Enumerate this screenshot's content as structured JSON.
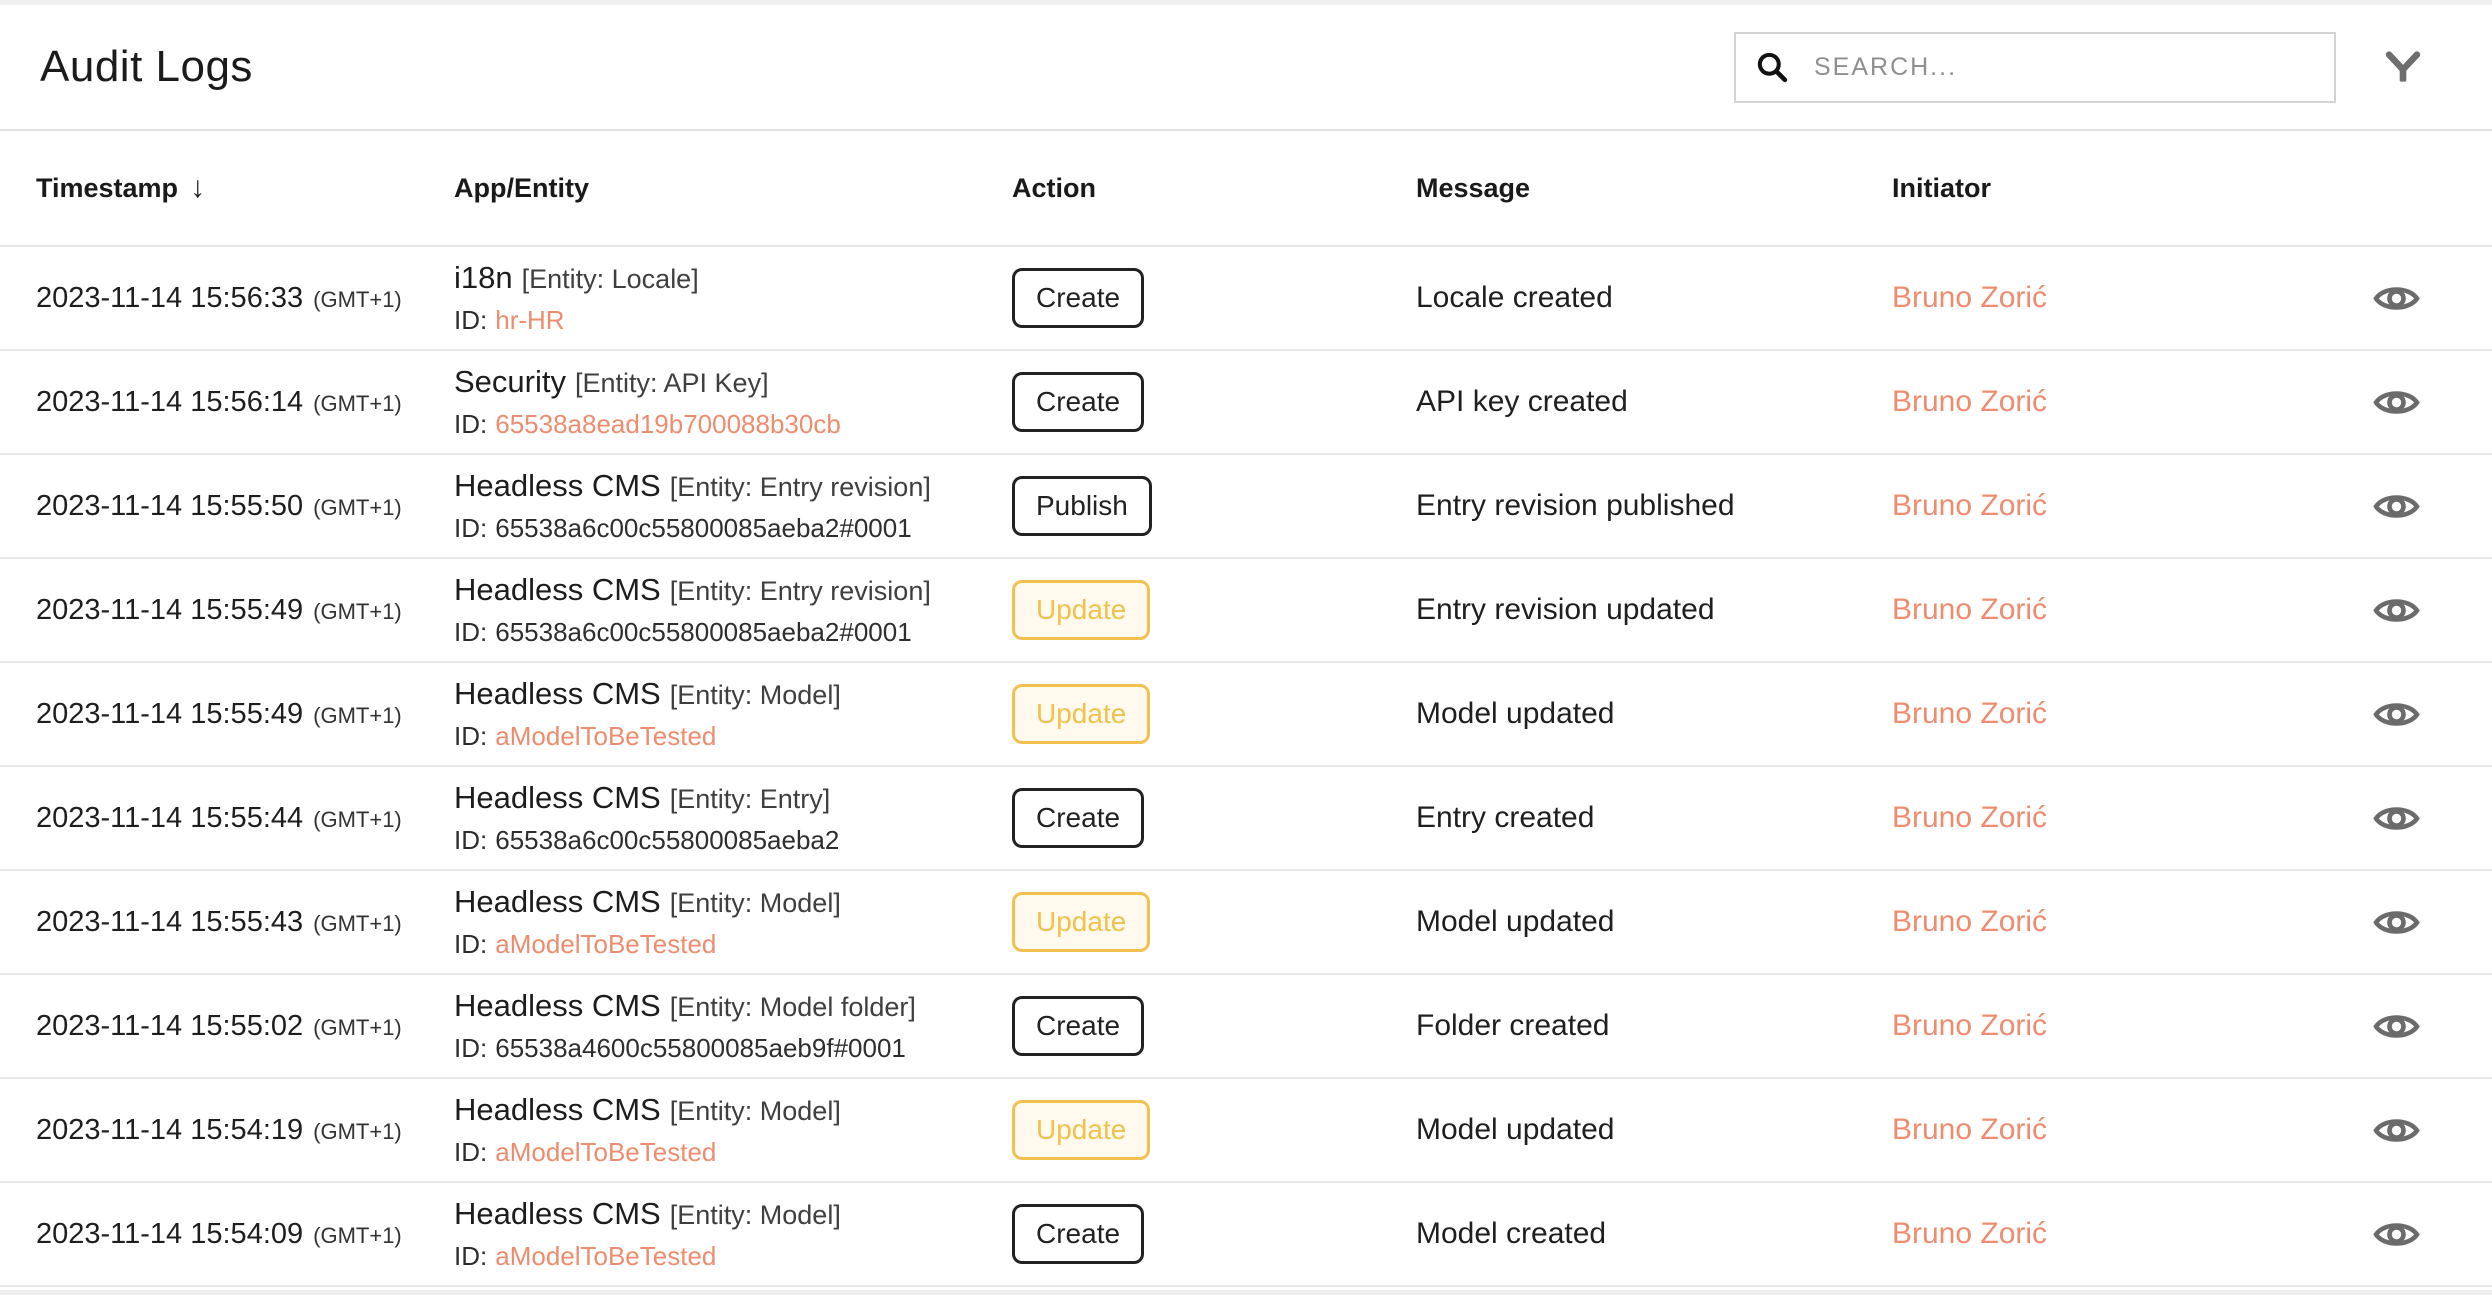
{
  "header": {
    "title": "Audit Logs",
    "search_placeholder": "SEARCH...",
    "icons": {
      "search": "magnifier-icon",
      "filter": "funnel-filter-icon"
    }
  },
  "table": {
    "columns": [
      {
        "label": "Timestamp",
        "sorted": "desc"
      },
      {
        "label": "App/Entity"
      },
      {
        "label": "Action"
      },
      {
        "label": "Message"
      },
      {
        "label": "Initiator"
      }
    ],
    "sort_arrow": "↓",
    "row_action_icon": "eye-icon",
    "rows": [
      {
        "timestamp": "2023-11-14 15:56:33",
        "timezone": "(GMT+1)",
        "app": "i18n",
        "entity": "[Entity: Locale]",
        "id_label": "ID:",
        "id": "hr-HR",
        "id_is_link": true,
        "action": "Create",
        "action_style": "dark",
        "message": "Locale created",
        "initiator": "Bruno Zorić"
      },
      {
        "timestamp": "2023-11-14 15:56:14",
        "timezone": "(GMT+1)",
        "app": "Security",
        "entity": "[Entity: API Key]",
        "id_label": "ID:",
        "id": "65538a8ead19b700088b30cb",
        "id_is_link": true,
        "action": "Create",
        "action_style": "dark",
        "message": "API key created",
        "initiator": "Bruno Zorić"
      },
      {
        "timestamp": "2023-11-14 15:55:50",
        "timezone": "(GMT+1)",
        "app": "Headless CMS",
        "entity": "[Entity: Entry revision]",
        "id_label": "ID:",
        "id": "65538a6c00c55800085aeba2#0001",
        "id_is_link": false,
        "action": "Publish",
        "action_style": "dark",
        "message": "Entry revision published",
        "initiator": "Bruno Zorić"
      },
      {
        "timestamp": "2023-11-14 15:55:49",
        "timezone": "(GMT+1)",
        "app": "Headless CMS",
        "entity": "[Entity: Entry revision]",
        "id_label": "ID:",
        "id": "65538a6c00c55800085aeba2#0001",
        "id_is_link": false,
        "action": "Update",
        "action_style": "warning",
        "message": "Entry revision updated",
        "initiator": "Bruno Zorić"
      },
      {
        "timestamp": "2023-11-14 15:55:49",
        "timezone": "(GMT+1)",
        "app": "Headless CMS",
        "entity": "[Entity: Model]",
        "id_label": "ID:",
        "id": "aModelToBeTested",
        "id_is_link": true,
        "action": "Update",
        "action_style": "warning",
        "message": "Model updated",
        "initiator": "Bruno Zorić"
      },
      {
        "timestamp": "2023-11-14 15:55:44",
        "timezone": "(GMT+1)",
        "app": "Headless CMS",
        "entity": "[Entity: Entry]",
        "id_label": "ID:",
        "id": "65538a6c00c55800085aeba2",
        "id_is_link": false,
        "action": "Create",
        "action_style": "dark",
        "message": "Entry created",
        "initiator": "Bruno Zorić"
      },
      {
        "timestamp": "2023-11-14 15:55:43",
        "timezone": "(GMT+1)",
        "app": "Headless CMS",
        "entity": "[Entity: Model]",
        "id_label": "ID:",
        "id": "aModelToBeTested",
        "id_is_link": true,
        "action": "Update",
        "action_style": "warning",
        "message": "Model updated",
        "initiator": "Bruno Zorić"
      },
      {
        "timestamp": "2023-11-14 15:55:02",
        "timezone": "(GMT+1)",
        "app": "Headless CMS",
        "entity": "[Entity: Model folder]",
        "id_label": "ID:",
        "id": "65538a4600c55800085aeb9f#0001",
        "id_is_link": false,
        "action": "Create",
        "action_style": "dark",
        "message": "Folder created",
        "initiator": "Bruno Zorić"
      },
      {
        "timestamp": "2023-11-14 15:54:19",
        "timezone": "(GMT+1)",
        "app": "Headless CMS",
        "entity": "[Entity: Model]",
        "id_label": "ID:",
        "id": "aModelToBeTested",
        "id_is_link": true,
        "action": "Update",
        "action_style": "warning",
        "message": "Model updated",
        "initiator": "Bruno Zorić"
      },
      {
        "timestamp": "2023-11-14 15:54:09",
        "timezone": "(GMT+1)",
        "app": "Headless CMS",
        "entity": "[Entity: Model]",
        "id_label": "ID:",
        "id": "aModelToBeTested",
        "id_is_link": true,
        "action": "Create",
        "action_style": "dark",
        "message": "Model created",
        "initiator": "Bruno Zorić"
      }
    ]
  },
  "colors": {
    "link_salmon": "#ED8C6E",
    "badge_amber": "#F2C14D",
    "badge_dark": "#222222",
    "icon_gray": "#6B6B6B",
    "divider": "#E9E9E9"
  }
}
